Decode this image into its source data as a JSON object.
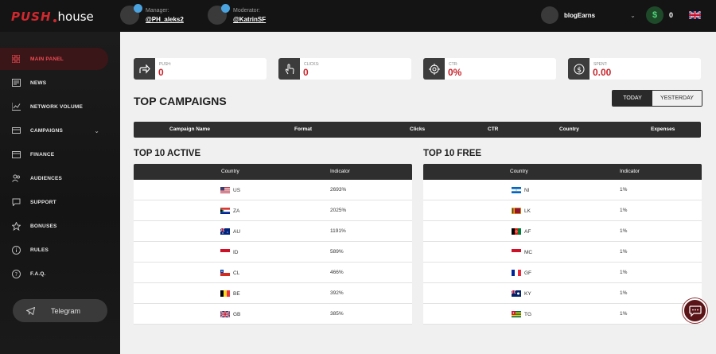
{
  "header": {
    "logo_push": "PUSH",
    "logo_house": "house",
    "manager_role": "Manager:",
    "manager_handle": "@PH_aleks2",
    "moderator_role": "Moderator:",
    "moderator_handle": "@KatrinSF",
    "account_name": "blogEarns",
    "balance": "0",
    "language": "EN"
  },
  "sidebar": {
    "items": [
      {
        "label": "MAIN PANEL",
        "icon": "grid-icon",
        "active": true
      },
      {
        "label": "NEWS",
        "icon": "newspaper-icon"
      },
      {
        "label": "NETWORK VOLUME",
        "icon": "chart-icon"
      },
      {
        "label": "CAMPAIGNS",
        "icon": "campaigns-icon"
      },
      {
        "label": "FINANCE",
        "icon": "card-icon"
      },
      {
        "label": "AUDIENCES",
        "icon": "users-icon"
      },
      {
        "label": "SUPPORT",
        "icon": "support-icon"
      },
      {
        "label": "BONUSES",
        "icon": "star-icon"
      },
      {
        "label": "RULES",
        "icon": "info-icon"
      },
      {
        "label": "F.A.Q.",
        "icon": "question-icon"
      }
    ],
    "telegram_label": "Telegram"
  },
  "stats": [
    {
      "label": "PUSH:",
      "value": "0",
      "icon": "arrow-forward-icon"
    },
    {
      "label": "CLICKS:",
      "value": "0",
      "icon": "hand-click-icon"
    },
    {
      "label": "CTR:",
      "value": "0%",
      "icon": "target-icon"
    },
    {
      "label": "SPENT:",
      "value": "0.00",
      "icon": "dollar-icon"
    }
  ],
  "campaigns": {
    "title": "TOP CAMPAIGNS",
    "today_label": "TODAY",
    "yesterday_label": "YESTERDAY",
    "columns": [
      "Campaign Name",
      "Format",
      "Clicks",
      "CTR",
      "Country",
      "Expenses"
    ]
  },
  "top_active": {
    "title": "TOP 10 ACTIVE",
    "columns": [
      "Country",
      "Indicator"
    ],
    "rows": [
      {
        "country": "US",
        "value": "2693%",
        "flag": "us"
      },
      {
        "country": "ZA",
        "value": "2025%",
        "flag": "za"
      },
      {
        "country": "AU",
        "value": "1191%",
        "flag": "au"
      },
      {
        "country": "ID",
        "value": "589%",
        "flag": "id"
      },
      {
        "country": "CL",
        "value": "466%",
        "flag": "cl"
      },
      {
        "country": "BE",
        "value": "392%",
        "flag": "be"
      },
      {
        "country": "GB",
        "value": "385%",
        "flag": "gb"
      }
    ]
  },
  "top_free": {
    "title": "TOP 10 FREE",
    "columns": [
      "Country",
      "Indicator"
    ],
    "rows": [
      {
        "country": "NI",
        "value": "1%",
        "flag": "ni"
      },
      {
        "country": "LK",
        "value": "1%",
        "flag": "lk"
      },
      {
        "country": "AF",
        "value": "1%",
        "flag": "af"
      },
      {
        "country": "MC",
        "value": "1%",
        "flag": "mc"
      },
      {
        "country": "GF",
        "value": "1%",
        "flag": "gf"
      },
      {
        "country": "KY",
        "value": "1%",
        "flag": "ky"
      },
      {
        "country": "TG",
        "value": "1%",
        "flag": "tg"
      }
    ]
  },
  "colors": {
    "accent": "#c9252c",
    "dark": "#2e2e2e",
    "sidebar": "#161616"
  }
}
